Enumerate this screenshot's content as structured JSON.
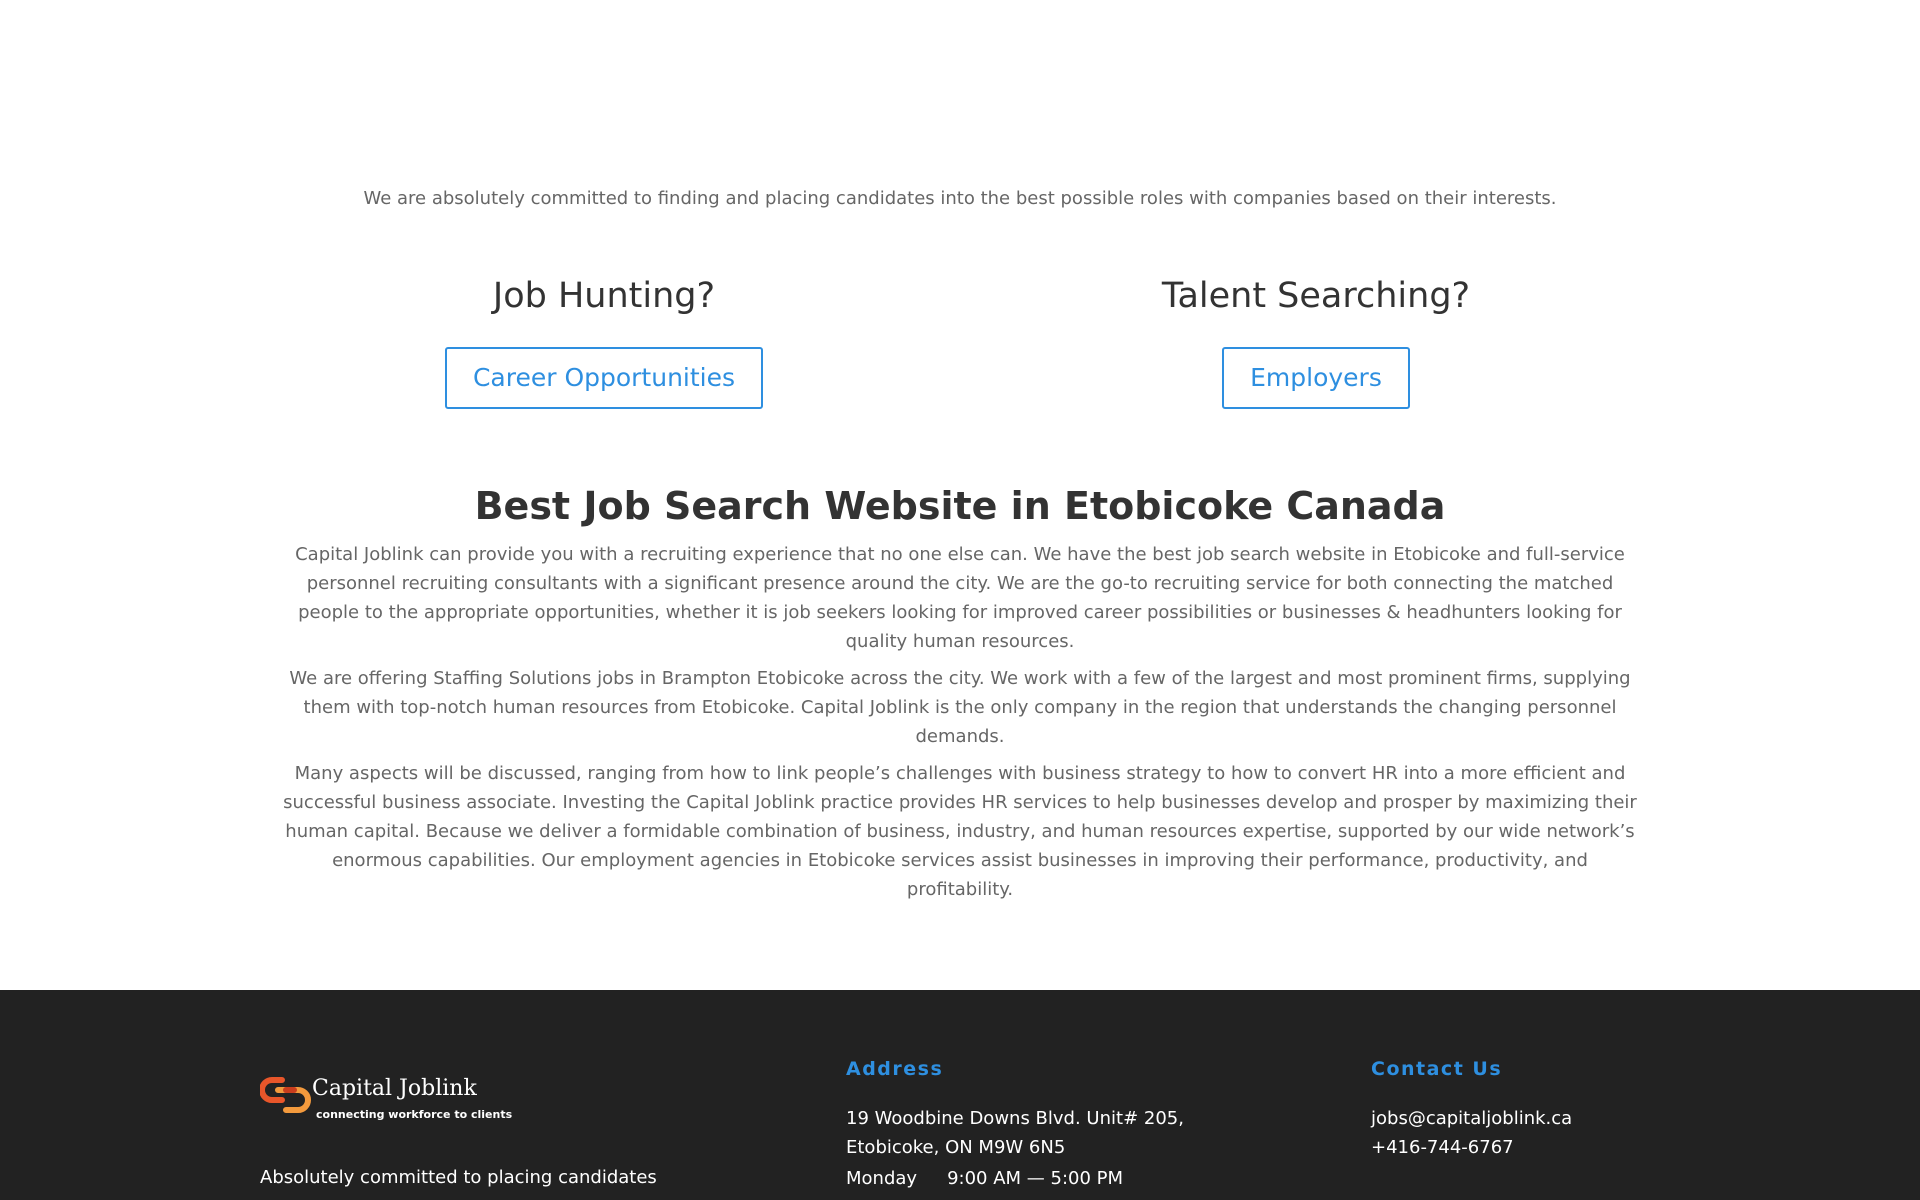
{
  "intro": {
    "text": "We are absolutely committed to finding and placing candidates into the best possible roles with companies based on their interests."
  },
  "cta": {
    "left": {
      "title": "Job Hunting?",
      "button_label": "Career Opportunities"
    },
    "right": {
      "title": "Talent Searching?",
      "button_label": "Employers"
    }
  },
  "main": {
    "heading": "Best Job Search Website in Etobicoke Canada",
    "paragraphs": [
      "Capital Joblink can provide you with a recruiting experience that no one else can. We have the best job search website in Etobicoke and full-service personnel recruiting consultants with a significant presence around the city. We are the go-to recruiting service for both connecting the matched people to the appropriate opportunities, whether it is job seekers looking for improved career possibilities or businesses & headhunters looking for quality human resources.",
      "We are offering Staffing Solutions jobs in Brampton Etobicoke across the city. We work with a few of the largest and most prominent firms, supplying them with top-notch human resources from Etobicoke. Capital Joblink is the only company in the region that understands the changing personnel demands.",
      "Many aspects will be discussed, ranging from how to link people’s challenges with business strategy to how to convert HR into a more efficient and successful business associate. Investing the Capital Joblink practice provides HR services to help businesses develop and prosper by maximizing their human capital. Because we deliver a formidable combination of business, industry, and human resources expertise, supported by our wide network’s enormous capabilities. Our employment agencies in Etobicoke services assist businesses in improving their performance, productivity, and profitability."
    ]
  },
  "footer": {
    "logo": {
      "name": "Capital Joblink",
      "tagline": "connecting workforce to clients"
    },
    "description": "Absolutely committed to placing candidates",
    "address": {
      "heading": "Address",
      "line1": "19 Woodbine Downs Blvd. Unit# 205,",
      "line2": "Etobicoke, ON M9W 6N5",
      "hours_day": "Monday",
      "hours_time": "9:00 AM — 5:00 PM"
    },
    "contact": {
      "heading": "Contact Us",
      "email": "jobs@capitaljoblink.ca",
      "phone": "+416-744-6767"
    }
  },
  "colors": {
    "accent": "#2e8fe0",
    "footer_bg": "#222222",
    "heading": "#333333",
    "body_text": "#666666",
    "logo_orange": "#e8562a"
  }
}
